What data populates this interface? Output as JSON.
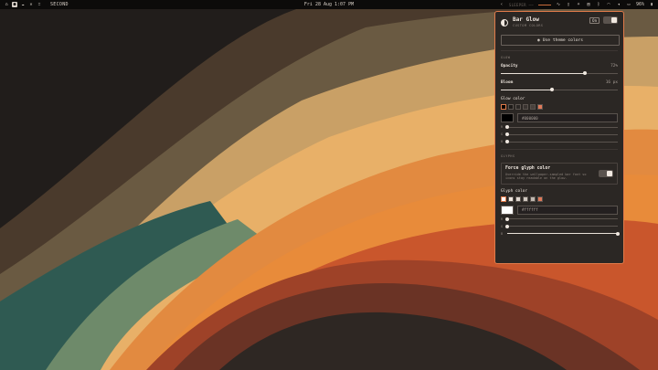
{
  "topbar": {
    "workspace": "SECOND",
    "clock": "Fri 28 Aug 1:07 PM",
    "media_title": "SLEEPER ——",
    "battery": "96%",
    "icons": [
      "home-icon",
      "person-icon",
      "cloud-icon",
      "close-x-icon",
      "grid-icon"
    ],
    "tray_icons": [
      "chevron-left-icon",
      "wave-icon",
      "phone-icon",
      "sun-icon",
      "clipboard-icon",
      "bluetooth-icon",
      "wifi-icon",
      "volume-icon",
      "display-icon",
      "battery-icon"
    ]
  },
  "panel": {
    "title": "Bar Glow",
    "subtitle": "CUSTOM COLORS",
    "on_badge": "On",
    "use_theme_button": "Use theme colors",
    "glow_section": "GLOW",
    "opacity_label": "Opacity",
    "opacity_value": "72%",
    "opacity_fraction": 0.72,
    "blooms_label": "Bloom",
    "blooms_value": "16 px",
    "bloom_fraction": 0.44,
    "glow_color_label": "Glow color",
    "glow_swatches": [
      "#000000",
      "#1e1b19",
      "#2a2624",
      "#3a3431",
      "#4a423d",
      "#e07a5a"
    ],
    "glow_hex": "#000000",
    "glow_channels": [
      {
        "label": "R",
        "fraction": 0.0
      },
      {
        "label": "G",
        "fraction": 0.0
      },
      {
        "label": "B",
        "fraction": 0.0
      }
    ],
    "glyphs_section": "GLYPHS",
    "force_title": "Force glyph color",
    "force_desc": "Override the wallpaper-sampled bar font so icons stay readable on the glow.",
    "glyph_color_label": "Glyph color",
    "glyph_swatches": [
      "#ffffff",
      "#f0e8e0",
      "#e0d8d0",
      "#d0c8c0",
      "#c0b8b0",
      "#e07a5a"
    ],
    "glyph_hex": "#ffffff",
    "glyph_channels": [
      {
        "label": "R",
        "fraction": 0.0
      },
      {
        "label": "G",
        "fraction": 0.0
      },
      {
        "label": "B",
        "fraction": 1.0
      }
    ]
  }
}
